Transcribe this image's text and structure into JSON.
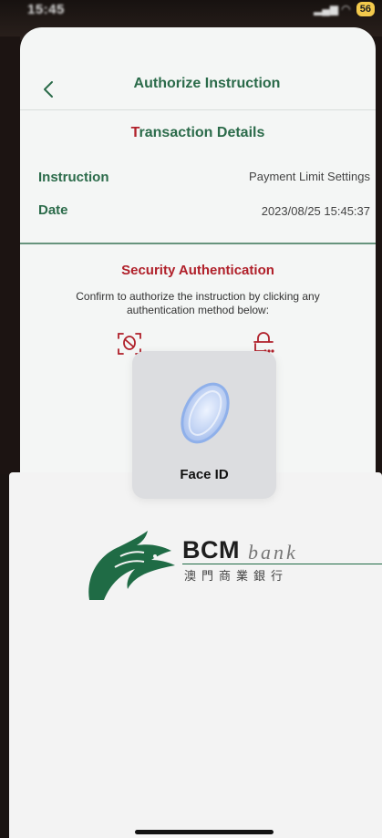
{
  "status_bar": {
    "time": "15:45",
    "battery": "56"
  },
  "header": {
    "title": "Authorize Instruction"
  },
  "transaction": {
    "title_accent": "T",
    "title_rest": "ransaction Details",
    "rows": [
      {
        "label": "Instruction",
        "value": "Payment Limit Settings"
      },
      {
        "label": "Date",
        "value": "2023/08/25 15:45:37"
      }
    ]
  },
  "security": {
    "title": "Security Authentication",
    "description": "Confirm to authorize the instruction by clicking any authentication method below:",
    "methods": [
      "face-id-icon",
      "password-lock-icon"
    ]
  },
  "face_id": {
    "label": "Face ID"
  },
  "brand": {
    "name": "BCM",
    "suffix": "bank",
    "chinese": "澳門商業銀行",
    "colors": {
      "green": "#2b6b4a",
      "red": "#b0202a",
      "logo_green": "#1f6b45"
    }
  }
}
